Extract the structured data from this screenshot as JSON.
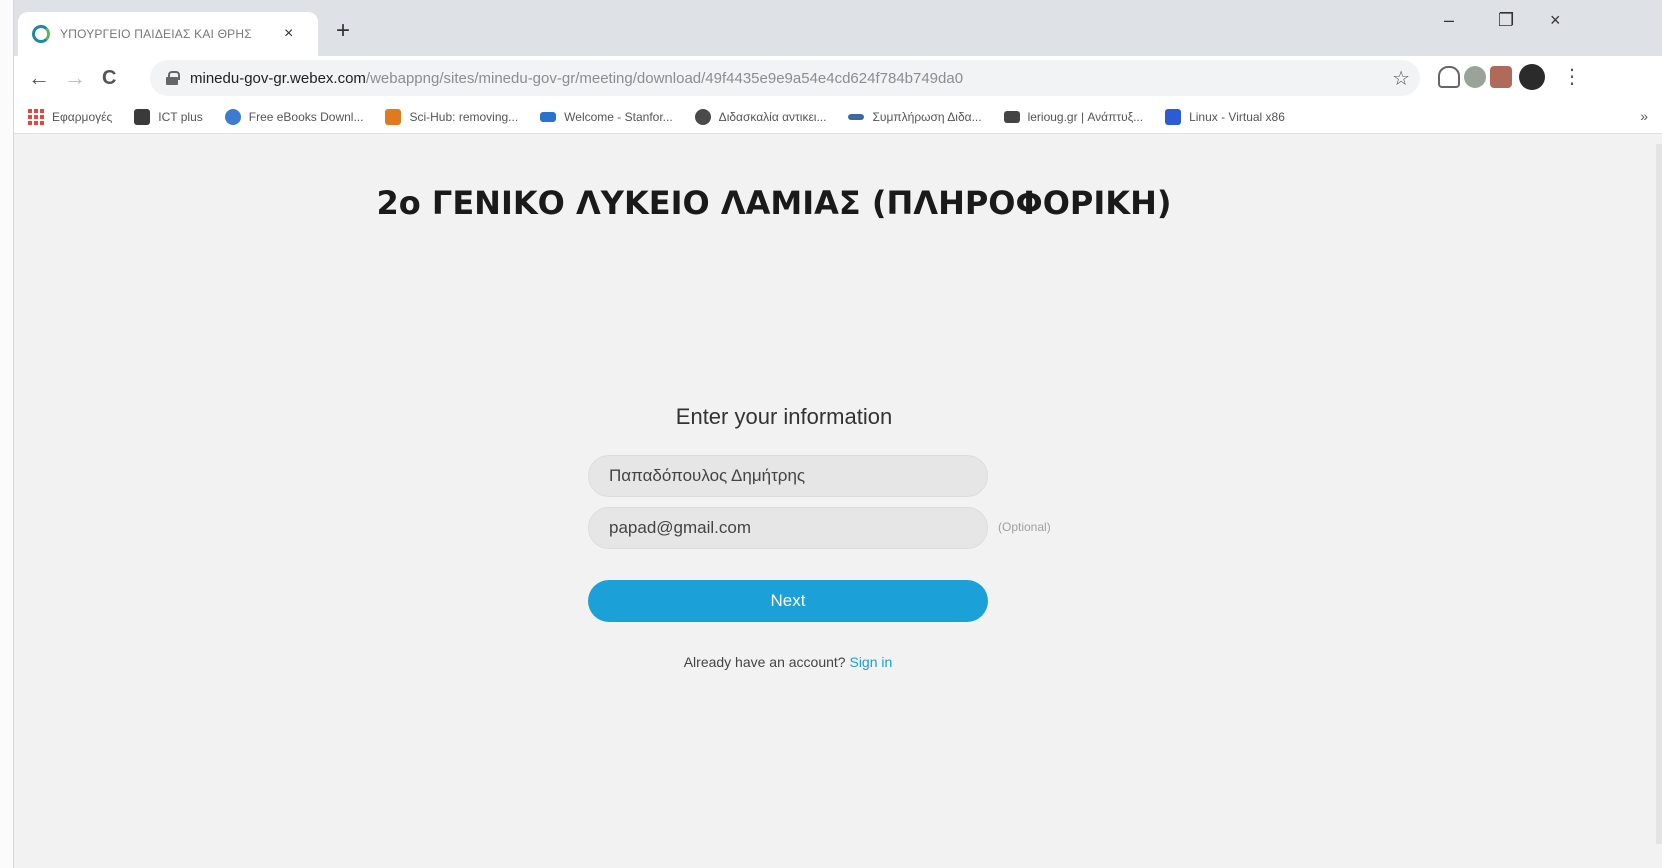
{
  "browser": {
    "tab": {
      "title": "ΥΠΟΥΡΓΕΙΟ ΠΑΙΔΕΙΑΣ ΚΑΙ ΘΡΗΣ",
      "close": "×"
    },
    "new_tab": "+",
    "window_controls": {
      "minimize": "–",
      "restore": "❐",
      "close": "×"
    },
    "nav": {
      "back": "←",
      "forward": "→",
      "reload": "C"
    },
    "address": {
      "domain": "minedu-gov-gr.webex.com",
      "path": "/webappng/sites/minedu-gov-gr/meeting/download/49f4435e9e9a54e4cd624f784b749da0"
    },
    "star": "☆",
    "menu": "⋮",
    "bookmarks_more": "»",
    "bookmarks": [
      {
        "label": "Εφαρμογές",
        "icon": "apps-grid-icon",
        "color": "#e8453c"
      },
      {
        "label": "ICT plus",
        "icon": "ict-plus-icon",
        "color": "#3a3a3a"
      },
      {
        "label": "Free eBooks Downl...",
        "icon": "ebook-icon",
        "color": "#3c7bd1"
      },
      {
        "label": "Sci-Hub: removing...",
        "icon": "scihub-icon",
        "color": "#e07a1f"
      },
      {
        "label": "Welcome - Stanfor...",
        "icon": "coursera-icon",
        "color": "#2a73cc"
      },
      {
        "label": "Διδασκαλία αντικει...",
        "icon": "globe-icon",
        "color": "#4a4a4a"
      },
      {
        "label": "Συμπλήρωση Διδα...",
        "icon": "form-icon",
        "color": "#3b6aa0"
      },
      {
        "label": "lerioug.gr | Ανάπτυξ...",
        "icon": "site-icon",
        "color": "#444444"
      },
      {
        "label": "Linux - Virtual x86",
        "icon": "linux-icon",
        "color": "#2d5bd6"
      }
    ]
  },
  "page": {
    "title": "2ο ΓΕΝΙΚΟ ΛΥΚΕΙΟ ΛΑΜΙΑΣ  (ΠΛΗΡΟΦΟΡΙΚΗ)",
    "form": {
      "heading": "Enter your information",
      "name_value": "Παπαδόπουλος Δημήτρης",
      "email_value": "papad@gmail.com",
      "optional": "(Optional)",
      "next_label": "Next",
      "account_prompt": "Already have an account?",
      "sign_in": "Sign in"
    },
    "colors": {
      "accent": "#1ba0d7",
      "background": "#f2f2f2"
    }
  }
}
